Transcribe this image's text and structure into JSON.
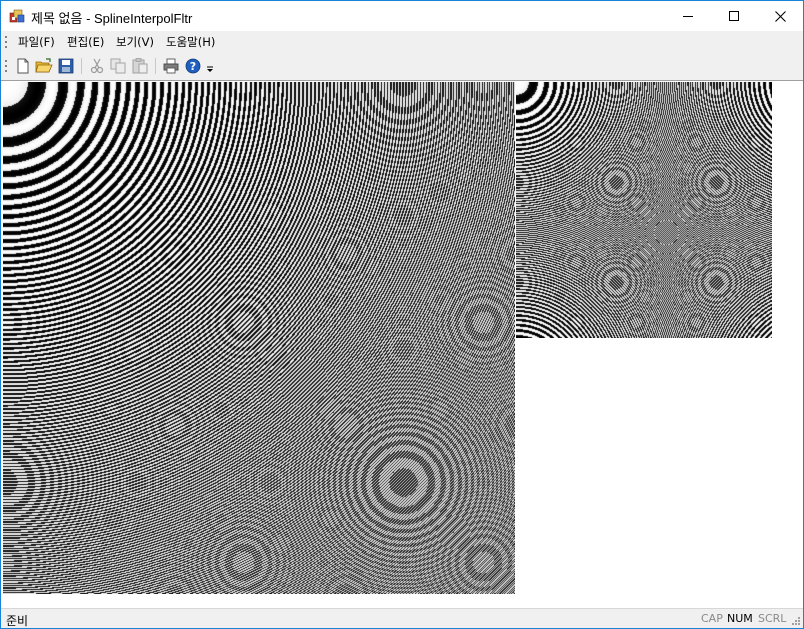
{
  "window": {
    "title": "제목 없음 - SplineInterpolFltr"
  },
  "menu": {
    "items": [
      {
        "label": "파일(F)"
      },
      {
        "label": "편집(E)"
      },
      {
        "label": "보기(V)"
      },
      {
        "label": "도움말(H)"
      }
    ]
  },
  "toolbar": {
    "buttons": [
      {
        "icon": "new-icon"
      },
      {
        "icon": "open-icon"
      },
      {
        "icon": "save-icon"
      },
      {
        "icon": "cut-icon",
        "enabled": false
      },
      {
        "icon": "copy-icon",
        "enabled": false
      },
      {
        "icon": "paste-icon",
        "enabled": false
      },
      {
        "icon": "print-icon"
      },
      {
        "icon": "help-icon"
      }
    ]
  },
  "statusbar": {
    "text": "준비",
    "indicators": [
      {
        "label": "CAP",
        "active": false
      },
      {
        "label": "NUM",
        "active": true
      },
      {
        "label": "SCRL",
        "active": false
      }
    ]
  },
  "colors": {
    "titlebar": "#ffffff",
    "border": "#1883d7",
    "chrome": "#f0f0f0",
    "help_blue": "#1f5fbf"
  }
}
